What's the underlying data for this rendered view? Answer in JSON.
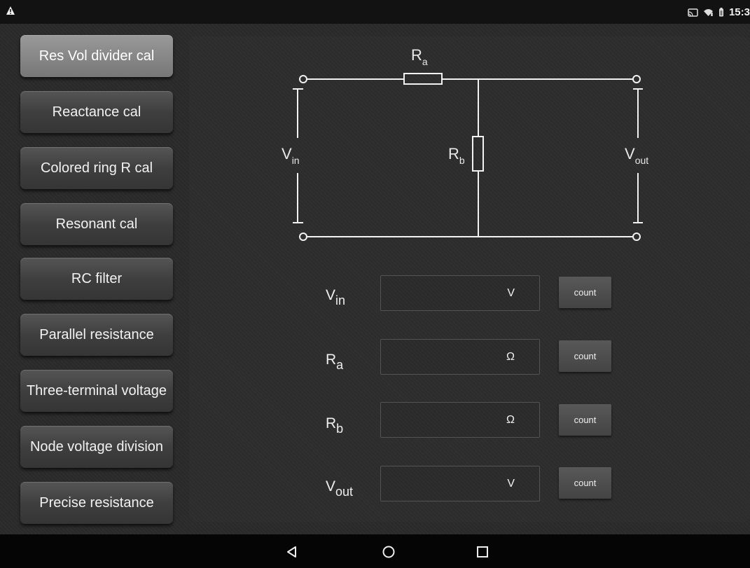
{
  "status": {
    "time": "15:3",
    "icons": [
      "warning-icon",
      "cast-icon",
      "wifi-icon",
      "battery-icon"
    ]
  },
  "sidebar": {
    "items": [
      {
        "label": "Res Vol divider cal"
      },
      {
        "label": "Reactance cal"
      },
      {
        "label": "Colored ring R cal"
      },
      {
        "label": "Resonant cal"
      },
      {
        "label": "RC filter"
      },
      {
        "label": "Parallel resistance"
      },
      {
        "label": "Three-terminal voltage"
      },
      {
        "label": "Node voltage division"
      },
      {
        "label": "Precise resistance"
      }
    ]
  },
  "circuit": {
    "ra": {
      "main": "R",
      "sub": "a"
    },
    "rb": {
      "main": "R",
      "sub": "b"
    },
    "vin": {
      "main": "V",
      "sub": "in"
    },
    "vout": {
      "main": "V",
      "sub": "out"
    }
  },
  "form": {
    "rows": [
      {
        "label_main": "V",
        "label_sub": "in",
        "unit": "V",
        "value": "",
        "placeholder": "",
        "button": "count"
      },
      {
        "label_main": "R",
        "label_sub": "a",
        "unit": "Ω",
        "value": "",
        "placeholder": "",
        "button": "count"
      },
      {
        "label_main": "R",
        "label_sub": "b",
        "unit": "Ω",
        "value": "",
        "placeholder": "",
        "button": "count"
      },
      {
        "label_main": "V",
        "label_sub": "out",
        "unit": "V",
        "value": "",
        "placeholder": "",
        "button": "count"
      }
    ]
  },
  "navbar": {
    "icons": [
      "back-icon",
      "home-icon",
      "recents-icon"
    ]
  }
}
